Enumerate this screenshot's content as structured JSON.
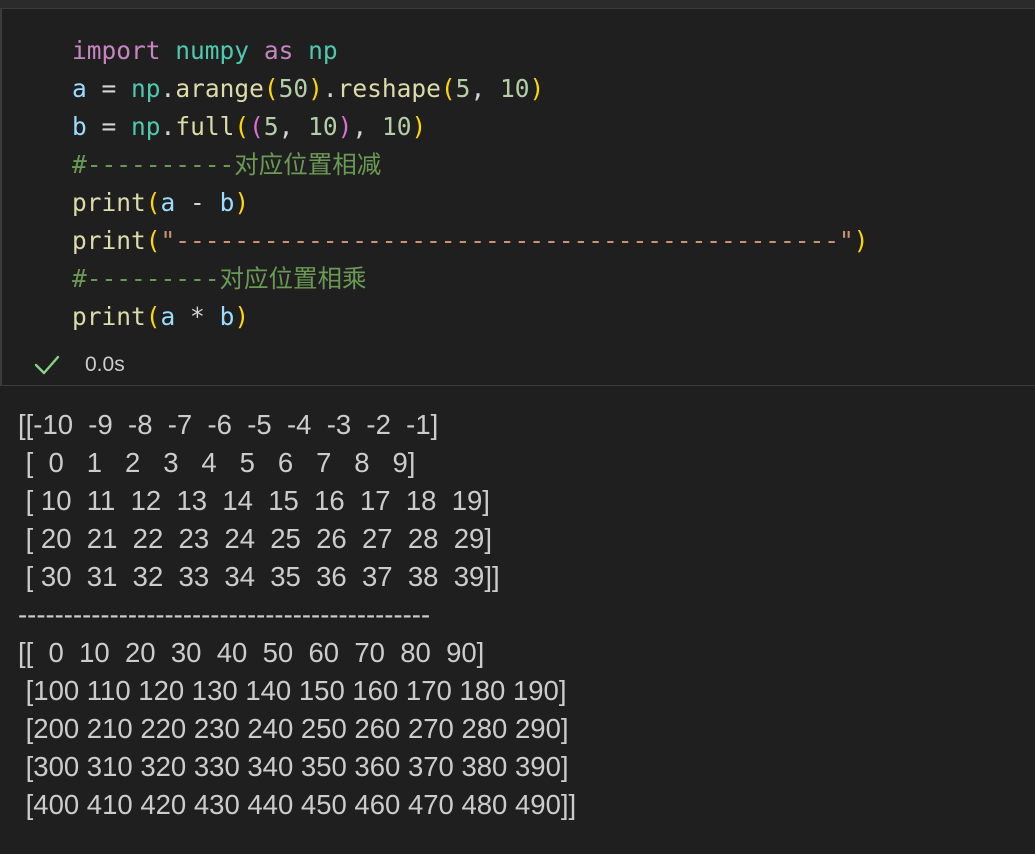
{
  "code": {
    "lines": [
      [
        {
          "t": "import",
          "c": "kw"
        },
        {
          "t": " ",
          "c": "op"
        },
        {
          "t": "numpy",
          "c": "mod"
        },
        {
          "t": " ",
          "c": "op"
        },
        {
          "t": "as",
          "c": "kw"
        },
        {
          "t": " ",
          "c": "op"
        },
        {
          "t": "np",
          "c": "mod"
        }
      ],
      [
        {
          "t": "a",
          "c": "var"
        },
        {
          "t": " = ",
          "c": "op"
        },
        {
          "t": "np",
          "c": "mod"
        },
        {
          "t": ".",
          "c": "op"
        },
        {
          "t": "arange",
          "c": "fn"
        },
        {
          "t": "(",
          "c": "b1"
        },
        {
          "t": "50",
          "c": "num"
        },
        {
          "t": ")",
          "c": "b1"
        },
        {
          "t": ".",
          "c": "op"
        },
        {
          "t": "reshape",
          "c": "fn"
        },
        {
          "t": "(",
          "c": "b1"
        },
        {
          "t": "5",
          "c": "num"
        },
        {
          "t": ", ",
          "c": "op"
        },
        {
          "t": "10",
          "c": "num"
        },
        {
          "t": ")",
          "c": "b1"
        }
      ],
      [
        {
          "t": "b",
          "c": "var"
        },
        {
          "t": " = ",
          "c": "op"
        },
        {
          "t": "np",
          "c": "mod"
        },
        {
          "t": ".",
          "c": "op"
        },
        {
          "t": "full",
          "c": "fn"
        },
        {
          "t": "(",
          "c": "b1"
        },
        {
          "t": "(",
          "c": "b2"
        },
        {
          "t": "5",
          "c": "num"
        },
        {
          "t": ", ",
          "c": "op"
        },
        {
          "t": "10",
          "c": "num"
        },
        {
          "t": ")",
          "c": "b2"
        },
        {
          "t": ", ",
          "c": "op"
        },
        {
          "t": "10",
          "c": "num"
        },
        {
          "t": ")",
          "c": "b1"
        }
      ],
      [
        {
          "t": "#----------对应位置相减",
          "c": "cmt"
        }
      ],
      [
        {
          "t": "print",
          "c": "fn"
        },
        {
          "t": "(",
          "c": "b1"
        },
        {
          "t": "a",
          "c": "var"
        },
        {
          "t": " - ",
          "c": "op"
        },
        {
          "t": "b",
          "c": "var"
        },
        {
          "t": ")",
          "c": "b1"
        }
      ],
      [
        {
          "t": "print",
          "c": "fn"
        },
        {
          "t": "(",
          "c": "b1"
        },
        {
          "t": "\"---------------------------------------------\"",
          "c": "str"
        },
        {
          "t": ")",
          "c": "b1"
        }
      ],
      [
        {
          "t": "#---------对应位置相乘",
          "c": "cmt"
        }
      ],
      [
        {
          "t": "print",
          "c": "fn"
        },
        {
          "t": "(",
          "c": "b1"
        },
        {
          "t": "a",
          "c": "var"
        },
        {
          "t": " * ",
          "c": "op"
        },
        {
          "t": "b",
          "c": "var"
        },
        {
          "t": ")",
          "c": "b1"
        }
      ]
    ]
  },
  "status": {
    "icon": "check-icon",
    "time": "0.0s"
  },
  "output": {
    "lines": [
      "[[-10  -9  -8  -7  -6  -5  -4  -3  -2  -1]",
      " [  0   1   2   3   4   5   6   7   8   9]",
      " [ 10  11  12  13  14  15  16  17  18  19]",
      " [ 20  21  22  23  24  25  26  27  28  29]",
      " [ 30  31  32  33  34  35  36  37  38  39]]",
      "---------------------------------------------",
      "[[  0  10  20  30  40  50  60  70  80  90]",
      " [100 110 120 130 140 150 160 170 180 190]",
      " [200 210 220 230 240 250 260 270 280 290]",
      " [300 310 320 330 340 350 360 370 380 390]",
      " [400 410 420 430 440 450 460 470 480 490]]"
    ]
  },
  "colors": {
    "background": "#1f1f1f",
    "keyword": "#c586c0",
    "module": "#4ec9b0",
    "variable": "#9cdcfe",
    "function": "#dcdcaa",
    "number": "#b5cea8",
    "string": "#ce9178",
    "comment": "#6a9955",
    "success": "#89d185"
  }
}
